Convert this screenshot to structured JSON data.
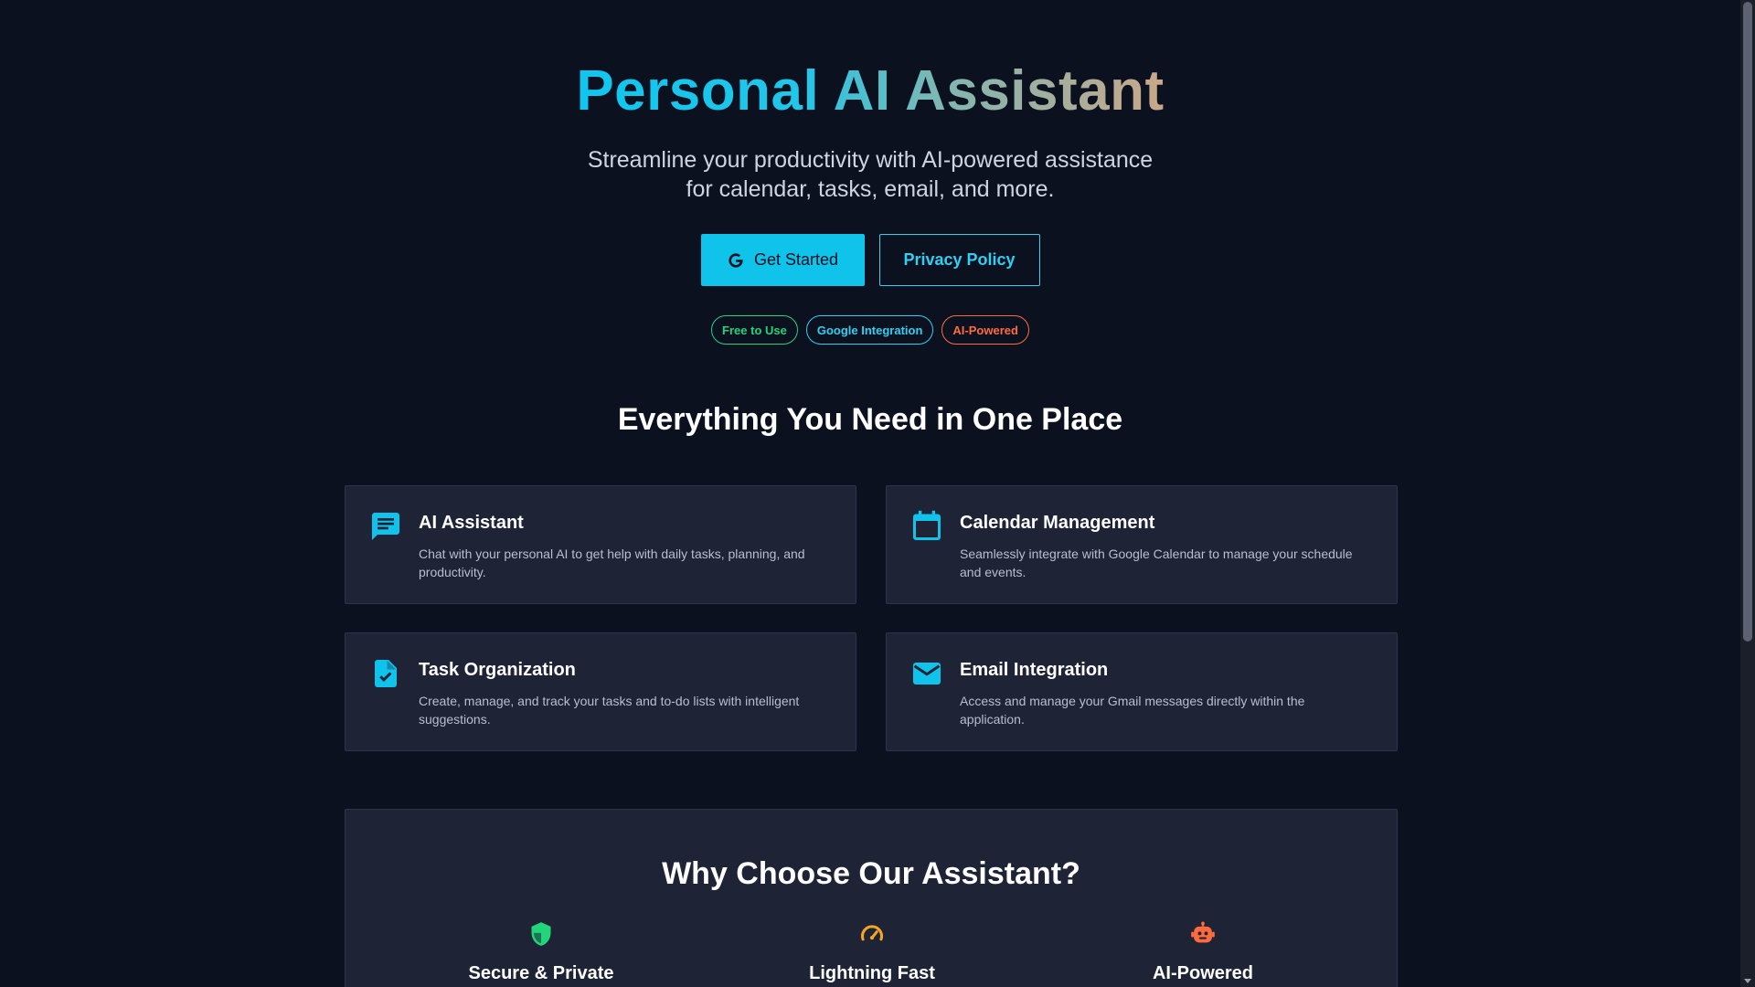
{
  "hero": {
    "title": "Personal AI Assistant",
    "subtitle_line1": "Streamline your productivity with AI-powered assistance",
    "subtitle_line2": "for calendar, tasks, email, and more."
  },
  "buttons": {
    "get_started": "Get Started",
    "privacy_policy": "Privacy Policy"
  },
  "badges": [
    {
      "label": "Free to Use",
      "color": "#22d47a"
    },
    {
      "label": "Google Integration",
      "color": "#2fd0f2"
    },
    {
      "label": "AI-Powered",
      "color": "#ff6b3d"
    }
  ],
  "features": {
    "title": "Everything You Need in One Place",
    "items": [
      {
        "icon": "chat-icon",
        "title": "AI Assistant",
        "desc": "Chat with your personal AI to get help with daily tasks, planning, and productivity."
      },
      {
        "icon": "calendar-icon",
        "title": "Calendar Management",
        "desc": "Seamlessly integrate with Google Calendar to manage your schedule and events."
      },
      {
        "icon": "task-icon",
        "title": "Task Organization",
        "desc": "Create, manage, and track your tasks and to-do lists with intelligent suggestions."
      },
      {
        "icon": "email-icon",
        "title": "Email Integration",
        "desc": "Access and manage your Gmail messages directly within the application."
      }
    ]
  },
  "why": {
    "title": "Why Choose Our Assistant?",
    "items": [
      {
        "icon": "shield-icon",
        "title": "Secure & Private",
        "color": "#22d47a"
      },
      {
        "icon": "speedometer-icon",
        "title": "Lightning Fast",
        "color": "#f3a623"
      },
      {
        "icon": "robot-icon",
        "title": "AI-Powered",
        "color": "#ff6b3d"
      }
    ]
  },
  "colors": {
    "accent": "#10c3ea",
    "background": "#0c1120",
    "card": "#1e2336"
  }
}
